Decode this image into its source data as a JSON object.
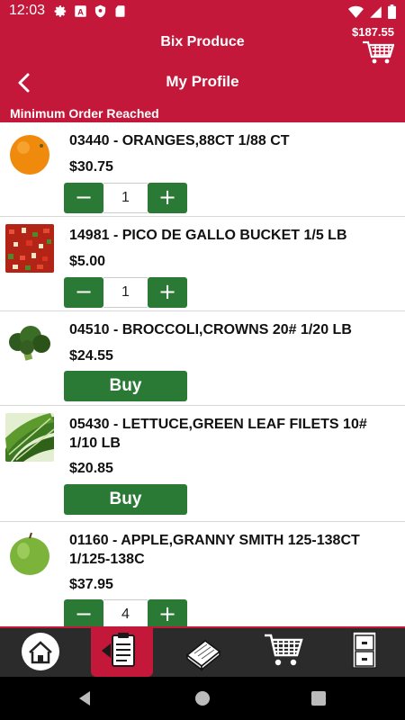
{
  "status": {
    "time": "12:03"
  },
  "header": {
    "app_title": "Bix Produce",
    "cart_total": "$187.55",
    "page_title": "My Profile",
    "notice": "Minimum Order Reached"
  },
  "products": [
    {
      "name": "03440 - ORANGES,88CT 1/88 CT",
      "price": "$30.75",
      "qty": "1",
      "image": "orange"
    },
    {
      "name": "14981 - PICO DE GALLO BUCKET 1/5 LB",
      "price": "$5.00",
      "qty": "1",
      "image": "pico-de-gallo"
    },
    {
      "name": "04510 - BROCCOLI,CROWNS 20# 1/20 LB",
      "price": "$24.55",
      "buy_label": "Buy",
      "image": "broccoli"
    },
    {
      "name": "05430 - LETTUCE,GREEN LEAF FILETS 10# 1/10 LB",
      "price": "$20.85",
      "buy_label": "Buy",
      "image": "lettuce"
    },
    {
      "name": "01160 - APPLE,GRANNY SMITH 125-138CT 1/125-138C",
      "price": "$37.95",
      "qty": "4",
      "image": "green-apple"
    }
  ],
  "stepper": {
    "minus": "−",
    "plus": "+"
  },
  "bottom_nav": [
    "home-icon",
    "order-guide-icon",
    "catalog-icon",
    "cart-icon",
    "cabinet-icon"
  ],
  "colors": {
    "brand": "#c4183a",
    "action": "#2a7a36",
    "nav_bg": "#2b2b2b"
  }
}
